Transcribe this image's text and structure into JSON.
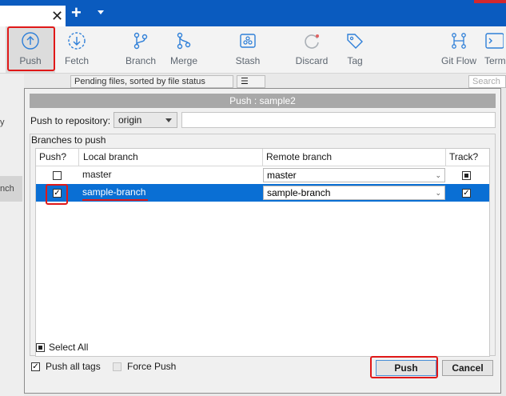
{
  "toolbar": {
    "push": "Push",
    "fetch": "Fetch",
    "branch": "Branch",
    "merge": "Merge",
    "stash": "Stash",
    "discard": "Discard",
    "tag": "Tag",
    "gitflow": "Git Flow",
    "terminal": "Term"
  },
  "tabbar": {
    "close": "✕",
    "add": "+"
  },
  "background": {
    "pending": "Pending files, sorted by file status",
    "menu": "☰",
    "search": "Search",
    "left_text_1": "y",
    "left_text_2": "nch"
  },
  "dialog": {
    "title": "Push :  sample2",
    "repo_label": "Push to repository:",
    "repo_value": "origin",
    "group_label": "Branches to push",
    "columns": {
      "push": "Push?",
      "local": "Local branch",
      "remote": "Remote branch",
      "track": "Track?"
    },
    "rows": [
      {
        "local": "master",
        "remote": "master",
        "push": false,
        "track": true
      },
      {
        "local": "sample-branch",
        "remote": "sample-branch",
        "push": true,
        "track": true
      }
    ],
    "select_all": "Select All",
    "push_all_tags": "Push all tags",
    "force_push": "Force Push",
    "push_button": "Push",
    "cancel_button": "Cancel"
  },
  "colors": {
    "accent": "#0a5bbf",
    "selection": "#0a6fd4",
    "annotation": "#e01818"
  }
}
